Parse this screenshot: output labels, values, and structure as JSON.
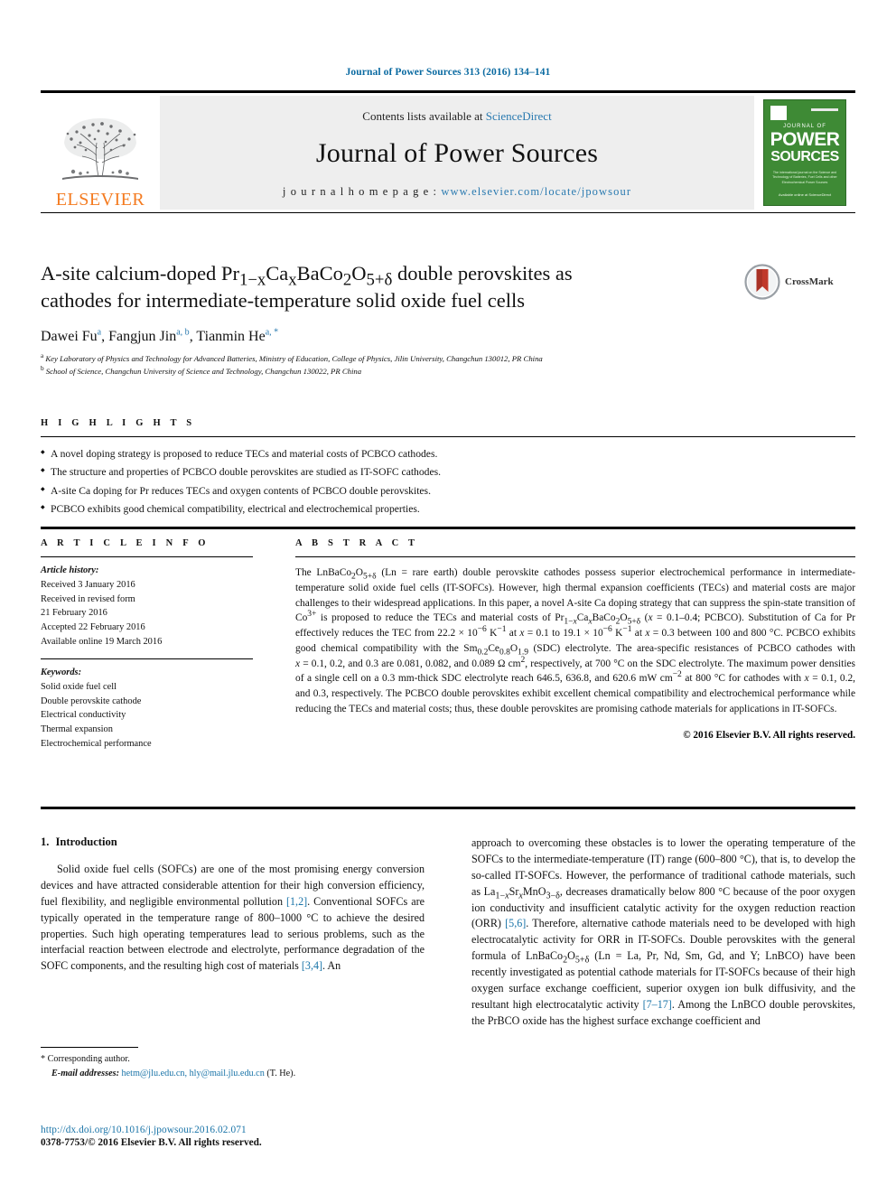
{
  "running_head": "Journal of Power Sources 313 (2016) 134–141",
  "masthead": {
    "publisher_logo_label": "ELSEVIER",
    "contents_prefix": "Contents lists available at ",
    "contents_link": "ScienceDirect",
    "journal_name": "Journal of Power Sources",
    "homepage_prefix": "j o u r n a l   h o m e p a g e :  ",
    "homepage_url": "www.elsevier.com/locate/jpowsour",
    "cover": {
      "journal_of": "JOURNAL OF",
      "power": "POWER",
      "sources": "SOURCES",
      "subtitle": "The international journal on the Science and Technology of Batteries, Fuel Cells and other Electrochemical Power Sources",
      "footer": "Available online at ScienceDirect"
    }
  },
  "article": {
    "title_line1_a": "A-site calcium-doped Pr",
    "title_sub1": "1−x",
    "title_line1_b": "Ca",
    "title_sub2": "x",
    "title_line1_c": "BaCo",
    "title_sub3": "2",
    "title_line1_d": "O",
    "title_sub4": "5+δ",
    "title_line1_e": " double perovskites as",
    "title_line2": "cathodes for intermediate-temperature solid oxide fuel cells",
    "title_plain": "A-site calcium-doped Pr1−xCaxBaCo2O5+δ double perovskites as cathodes for intermediate-temperature solid oxide fuel cells",
    "crossmark_label": "CrossMark",
    "authors": [
      {
        "name": "Dawei Fu",
        "marks": "a"
      },
      {
        "name": "Fangjun Jin",
        "marks": "a, b"
      },
      {
        "name": "Tianmin He",
        "marks": "a, *"
      }
    ],
    "affiliations": [
      {
        "mark": "a",
        "text": "Key Laboratory of Physics and Technology for Advanced Batteries, Ministry of Education, College of Physics, Jilin University, Changchun 130012, PR China"
      },
      {
        "mark": "b",
        "text": "School of Science, Changchun University of Science and Technology, Changchun 130022, PR China"
      }
    ]
  },
  "highlights": {
    "heading": "H I G H L I G H T S",
    "items": [
      "A novel doping strategy is proposed to reduce TECs and material costs of PCBCO cathodes.",
      "The structure and properties of PCBCO double perovskites are studied as IT-SOFC cathodes.",
      "A-site Ca doping for Pr reduces TECs and oxygen contents of PCBCO double perovskites.",
      "PCBCO exhibits good chemical compatibility, electrical and electrochemical properties."
    ]
  },
  "article_info": {
    "heading": "A R T I C L E   I N F O",
    "history_label": "Article history:",
    "history": [
      "Received 3 January 2016",
      "Received in revised form",
      "21 February 2016",
      "Accepted 22 February 2016",
      "Available online 19 March 2016"
    ],
    "keywords_label": "Keywords:",
    "keywords": [
      "Solid oxide fuel cell",
      "Double perovskite cathode",
      "Electrical conductivity",
      "Thermal expansion",
      "Electrochemical performance"
    ]
  },
  "abstract": {
    "heading": "A B S T R A C T",
    "copyright": "© 2016 Elsevier B.V. All rights reserved."
  },
  "introduction": {
    "number": "1.",
    "heading": "Introduction"
  },
  "footnote": {
    "corresponding": "* Corresponding author.",
    "email_label": "E-mail addresses:",
    "emails": "hetm@jlu.edu.cn, hly@mail.jlu.edu.cn",
    "email_suffix": " (T. He)."
  },
  "footer": {
    "doi": "http://dx.doi.org/10.1016/j.jpowsour.2016.02.071",
    "issn": "0378-7753/© 2016 Elsevier B.V. All rights reserved."
  },
  "colors": {
    "link": "#1a74a8",
    "running_head": "#0a6aa1",
    "elsevier_orange": "#f47b20",
    "cover_green": "#3e8a35",
    "band_gray": "#eeeeee"
  }
}
